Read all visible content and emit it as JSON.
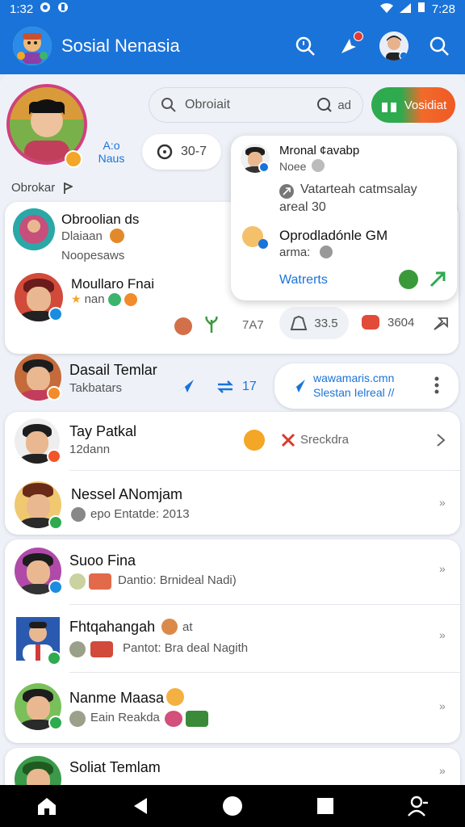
{
  "status_bar": {
    "time_left": "1:32",
    "time_right": "7:28"
  },
  "app_bar": {
    "title": "Sosial Nenasia"
  },
  "profile": {
    "stat_label": "A:o\nNaus"
  },
  "search": {
    "placeholder": "Obroiait",
    "trail_text": "ad"
  },
  "action_button": {
    "label": "Vosidiat"
  },
  "chip": {
    "value": "30-7"
  },
  "section": {
    "label": "Obrokar"
  },
  "popup": {
    "title": "Mronal ¢avabp",
    "subtitle": "Noee",
    "line1": "Vatarteah catmsalay",
    "line2": "areal 30",
    "item_title": "Oprodladónle GM",
    "item_sub": "arma:",
    "link": "Watrerts"
  },
  "feed_card": {
    "item1": {
      "name": "Obroolian ds",
      "sub1": "Dlaiaan",
      "sub2": "Noopesaws"
    },
    "item2": {
      "name": "Moullaro Fnai",
      "sub": "nan"
    },
    "footer": {
      "count1": "7A7",
      "count2": "33.5",
      "count3": "3604"
    }
  },
  "dasail_row": {
    "name": "Dasail Temlar",
    "sub": "Takbatars",
    "count": "17",
    "bubble_line1": "wawamaris.cmn",
    "bubble_line2": "Slestan Ielreal //"
  },
  "list1": [
    {
      "name": "Tay Patkal",
      "sub": "12dann",
      "action": "Sreckdra"
    },
    {
      "name": "Nessel ANomjam",
      "sub": "epo Entatde: 2013"
    }
  ],
  "list2": [
    {
      "name": "Suoo Fina",
      "sub": "Dantio: Brnideal Nadi)"
    },
    {
      "name": "Fhtqahangah",
      "tag": "at",
      "sub": "Pantot: Bra deal Nagith"
    },
    {
      "name": "Nanme Maasa",
      "sub": "Eain Reakda"
    },
    {
      "name": "Soliat Temlam"
    }
  ],
  "colors": {
    "brand": "#1a73d9",
    "accent_green": "#2eaa4f",
    "accent_orange": "#f26a2b"
  }
}
